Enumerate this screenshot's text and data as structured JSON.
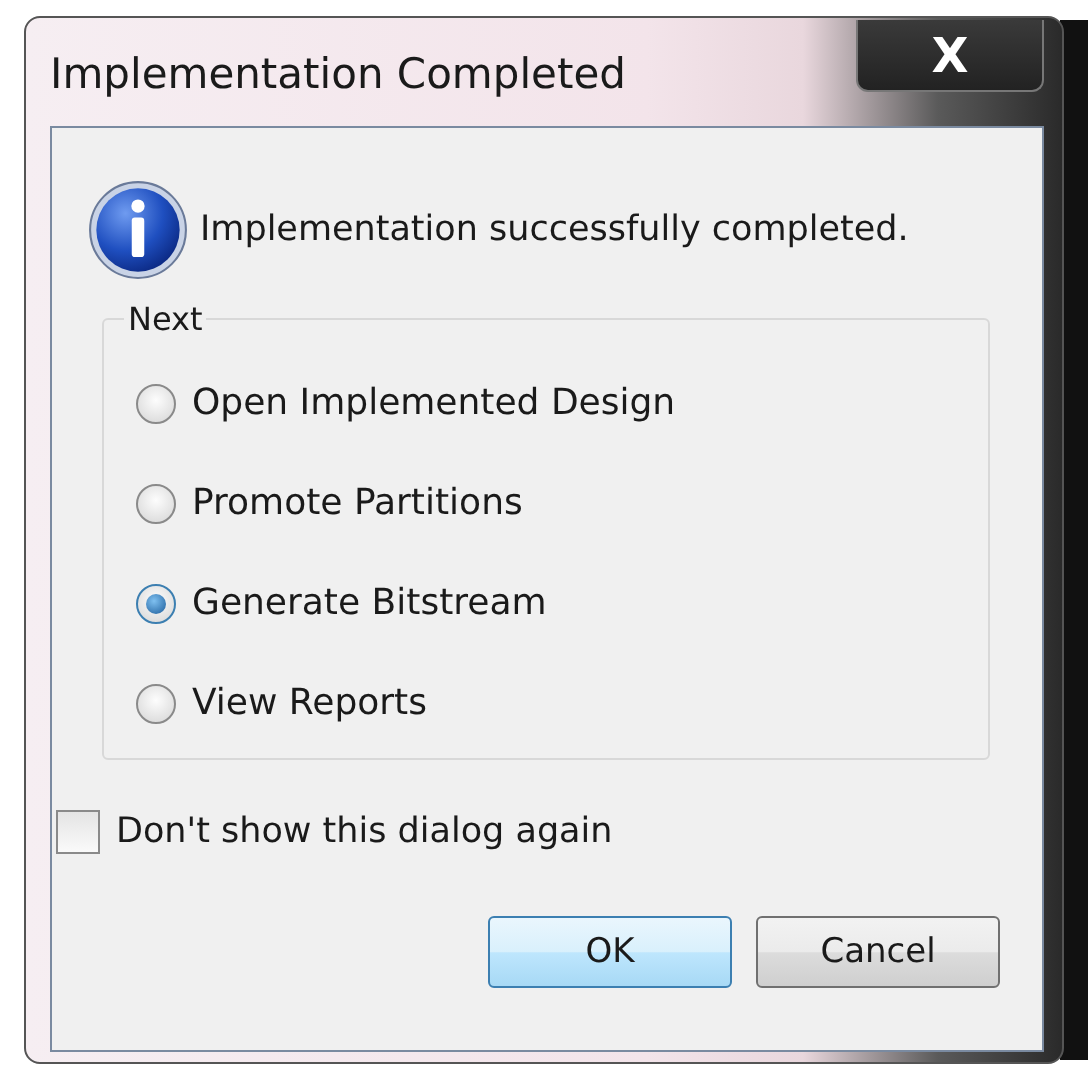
{
  "window": {
    "title": "Implementation Completed",
    "close_label": "X"
  },
  "message": "Implementation successfully completed.",
  "group": {
    "label": "Next",
    "options": [
      {
        "label": "Open Implemented Design",
        "selected": false
      },
      {
        "label": "Promote Partitions",
        "selected": false
      },
      {
        "label": "Generate Bitstream",
        "selected": true
      },
      {
        "label": "View Reports",
        "selected": false
      }
    ]
  },
  "checkbox": {
    "label": "Don't show this dialog again",
    "checked": false
  },
  "buttons": [
    {
      "label": "OK",
      "default": true
    },
    {
      "label": "Cancel",
      "default": false
    }
  ]
}
